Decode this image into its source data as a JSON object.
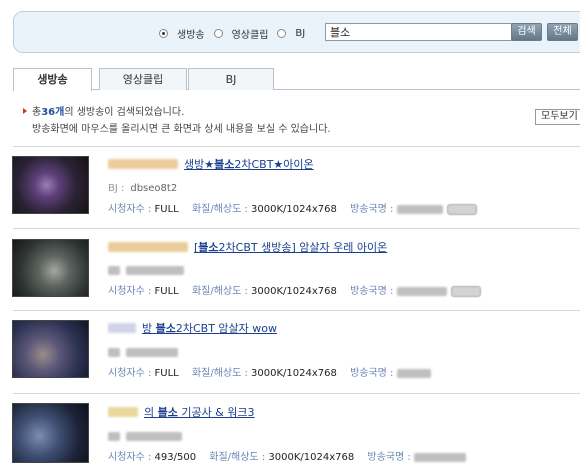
{
  "search": {
    "options": [
      {
        "label": "생방송",
        "checked": true
      },
      {
        "label": "영상클립",
        "checked": false
      },
      {
        "label": "BJ",
        "checked": false
      }
    ],
    "query": "블소",
    "search_button": "검색",
    "all_button": "전체"
  },
  "tabs": [
    {
      "label": "생방송",
      "active": true
    },
    {
      "label": "영상클립",
      "active": false
    },
    {
      "label": "BJ",
      "active": false
    }
  ],
  "summary": {
    "prefix": "총 ",
    "count": "36개",
    "suffix": "의 생방송이 검색되었습니다.",
    "hint": "방송화면에 마우스를 올리시면 큰 화면과 상세 내용을 보실 수 있습니다.",
    "view_button": "모두보기"
  },
  "labels": {
    "bj": "BJ :",
    "viewers": "시청자수 : ",
    "quality": "화질/해상도 : ",
    "channel": "방송국명 : "
  },
  "results": [
    {
      "title_pre": "생방",
      "title_hl": "★블소",
      "title_post": "2차CBT★아이온",
      "bj": "dbseo8t2",
      "viewers": "FULL",
      "quality": "3000K/1024x768"
    },
    {
      "title_pre": "[",
      "title_hl": "블소",
      "title_post": "2차CBT 생방송] 암살자 우레 아이온",
      "bj": "",
      "viewers": "FULL",
      "quality": "3000K/1024x768"
    },
    {
      "title_pre": "방 ",
      "title_hl": "블소",
      "title_post": "2차CBT 암살자 wow",
      "bj": "",
      "viewers": "FULL",
      "quality": "3000K/1024x768"
    },
    {
      "title_pre": "의 ",
      "title_hl": "블소",
      "title_post": " 기공사 & 워크3",
      "bj": "",
      "viewers": "493/500",
      "quality": "3000K/1024x768"
    }
  ],
  "colors": {
    "accent": "#1a3f8f",
    "panel_bg": "#eaf3fa",
    "label_blue": "#6a86b5"
  }
}
